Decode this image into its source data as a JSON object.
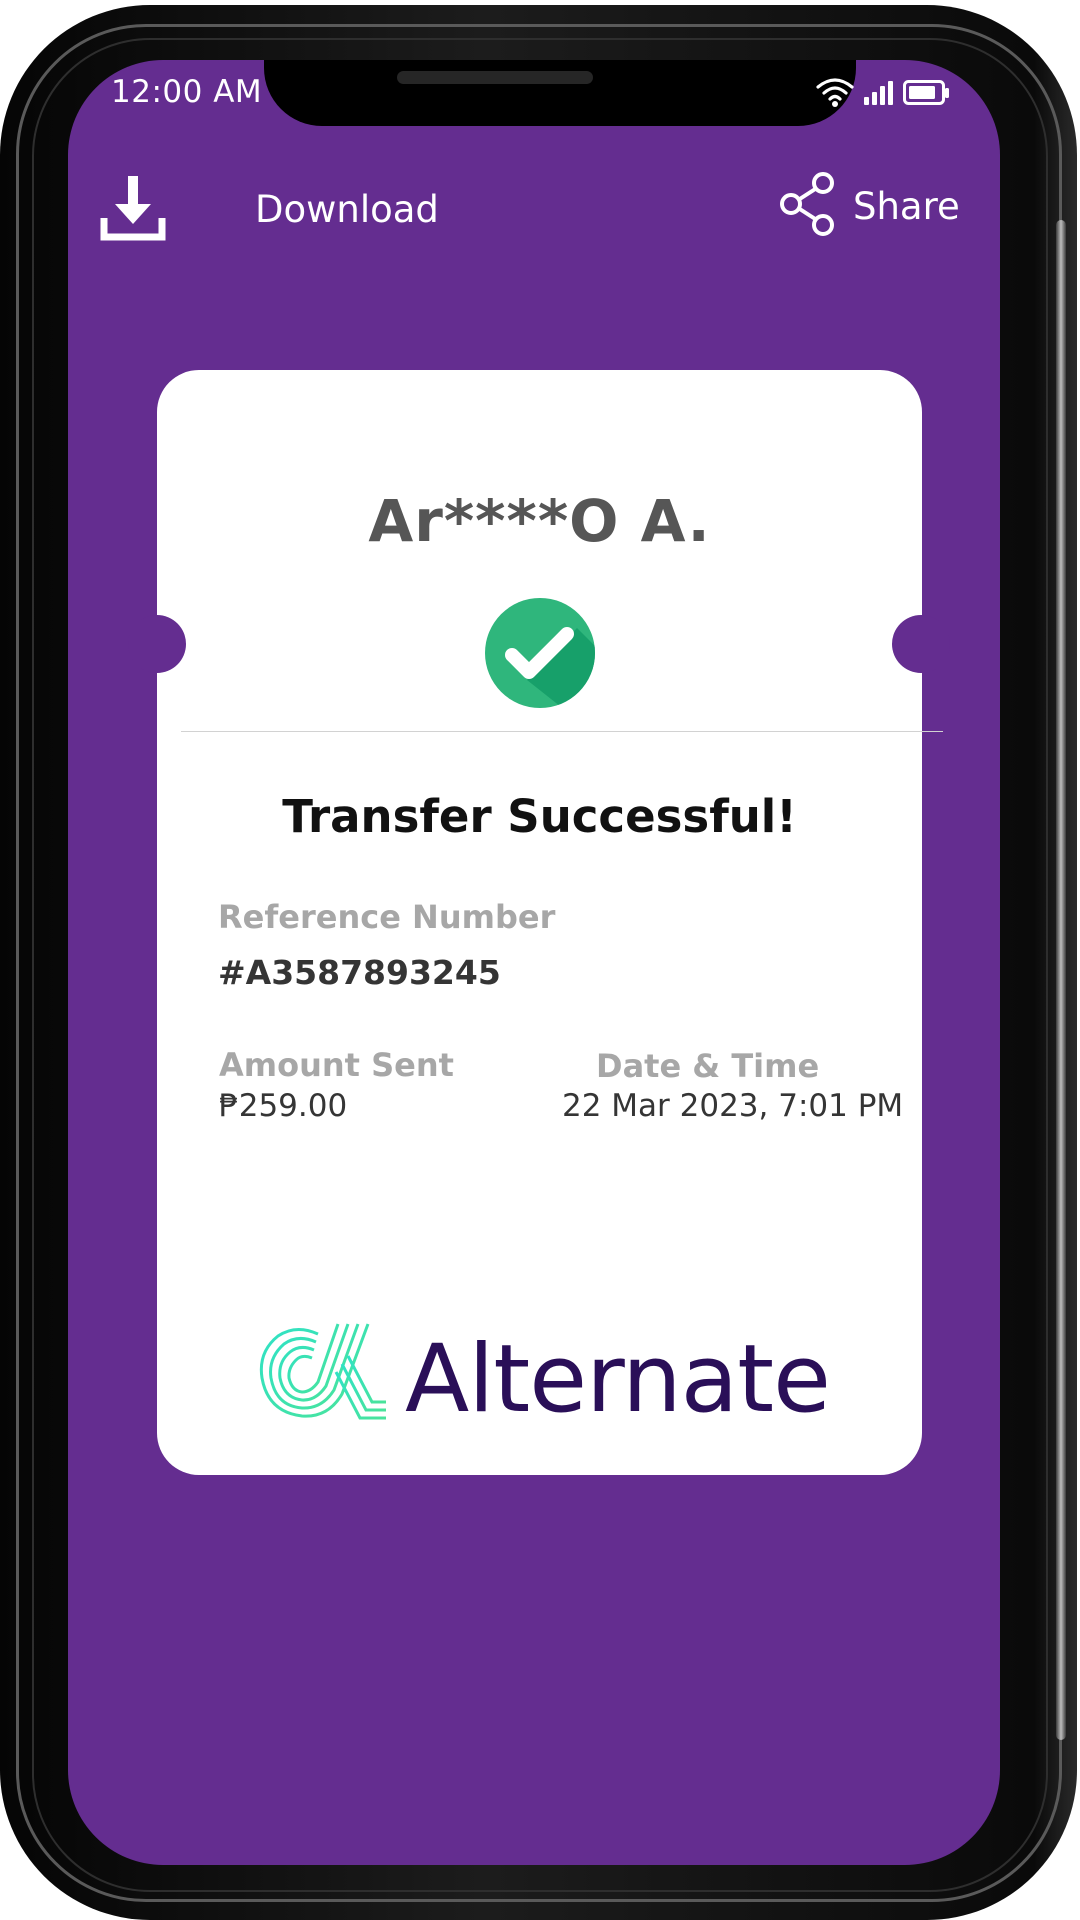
{
  "status_bar": {
    "time": "12:00 AM",
    "icons": [
      "wifi-icon",
      "cellular-signal-icon",
      "battery-icon"
    ]
  },
  "actions": {
    "download": {
      "label": "Download",
      "icon": "download-icon"
    },
    "share": {
      "label": "Share",
      "icon": "share-icon"
    }
  },
  "receipt": {
    "recipient_name": "Ar****O A.",
    "status_icon": "check-circle-icon",
    "title": "Transfer Successful!",
    "reference_label": "Reference Number",
    "reference_value": "#A3587893245",
    "amount_label": "Amount Sent",
    "amount_value": "₱259.00",
    "datetime_label": "Date & Time",
    "datetime_value": "22 Mar 2023, 7:01 PM"
  },
  "brand": {
    "name": "Alternate"
  },
  "colors": {
    "background_purple": "#642d90",
    "card": "#ffffff",
    "success_green": "#2fb67c",
    "success_green_dark": "#17a06a",
    "brand_text": "#2a0f58",
    "brand_mark_teal": "#2fe2c6",
    "brand_mark_green": "#4ae39a",
    "label_gray": "#a7a7a7",
    "value_dark": "#353535"
  }
}
